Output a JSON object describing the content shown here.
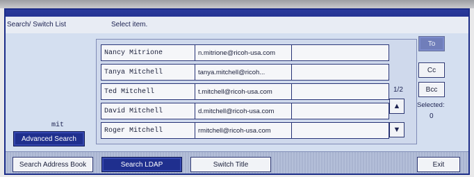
{
  "header": {
    "screen_title": "Search/ Switch List",
    "instruction": "Select item."
  },
  "left_panel": {
    "search_term": "mit",
    "advanced_search": "Advanced Search"
  },
  "results": [
    {
      "name": "Nancy Mitrione",
      "email": "n.mitrione@ricoh-usa.com"
    },
    {
      "name": "Tanya Mitchell",
      "email": "tanya.mitchell@ricoh..."
    },
    {
      "name": "Ted Mitchell",
      "email": "t.mitchell@ricoh-usa.com"
    },
    {
      "name": "David Mitchell",
      "email": "d.mitchell@ricoh-usa.com"
    },
    {
      "name": "Roger Mitchell",
      "email": "rmitchell@ricoh-usa.com"
    }
  ],
  "pagination": {
    "page": "1/2",
    "up_icon": "triangle-up-icon",
    "down_icon": "triangle-down-icon"
  },
  "right_panel": {
    "to": "To",
    "cc": "Cc",
    "bcc": "Bcc",
    "selected_label": "Selected:",
    "selected_count": "0"
  },
  "bottom": {
    "search_address_book": "Search Address Book",
    "search_ldap": "Search LDAP",
    "switch_title": "Switch Title",
    "exit": "Exit"
  },
  "colors": {
    "accent_dark": "#1f2f8e",
    "panel_bg": "#d4dff0"
  }
}
